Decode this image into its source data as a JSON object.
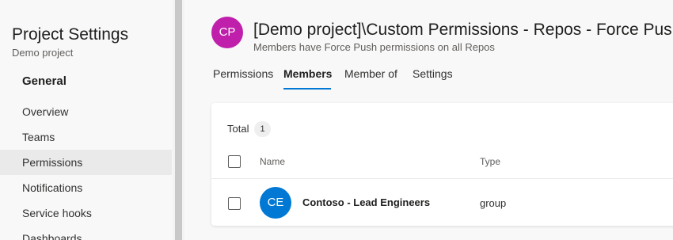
{
  "sidebar": {
    "title": "Project Settings",
    "project": "Demo project",
    "section": "General",
    "items": [
      {
        "label": "Overview"
      },
      {
        "label": "Teams"
      },
      {
        "label": "Permissions",
        "selected": true
      },
      {
        "label": "Notifications"
      },
      {
        "label": "Service hooks"
      },
      {
        "label": "Dashboards"
      }
    ]
  },
  "header": {
    "avatar_initials": "CP",
    "avatar_color": "#bf1faa",
    "title": "[Demo project]\\Custom Permissions - Repos - Force Push",
    "subtitle": "Members have Force Push permissions on all Repos"
  },
  "tabs": [
    {
      "label": "Permissions"
    },
    {
      "label": "Members",
      "active": true
    },
    {
      "label": "Member of"
    },
    {
      "label": "Settings"
    }
  ],
  "members": {
    "total_label": "Total",
    "total_count": "1",
    "columns": {
      "name": "Name",
      "type": "Type"
    },
    "rows": [
      {
        "initials": "CE",
        "avatar_color": "#0078d4",
        "name": "Contoso - Lead Engineers",
        "type": "group"
      }
    ]
  },
  "colors": {
    "accent": "#0078d4",
    "selected_bg": "#eaeaea"
  }
}
